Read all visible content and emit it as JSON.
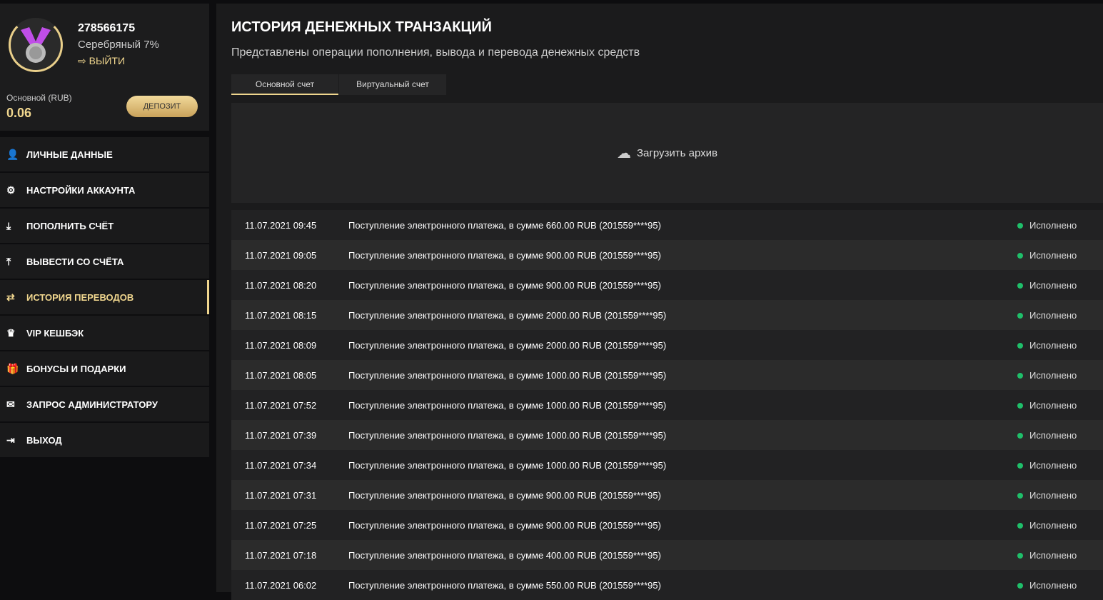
{
  "profile": {
    "user_id": "278566175",
    "rank": "Серебряный 7%",
    "logout": "ВЫЙТИ",
    "balance_label": "Основной (RUB)",
    "balance": "0.06",
    "deposit": "ДЕПОЗИТ"
  },
  "menu": [
    {
      "icon": "user-plus-icon",
      "glyph": "👤",
      "label": "ЛИЧНЫЕ ДАННЫЕ"
    },
    {
      "icon": "gears-icon",
      "glyph": "⚙",
      "label": "НАСТРОЙКИ АККАУНТА"
    },
    {
      "icon": "download-icon",
      "glyph": "⤓",
      "label": "ПОПОЛНИТЬ СЧЁТ"
    },
    {
      "icon": "upload-icon",
      "glyph": "⤒",
      "label": "ВЫВЕСТИ СО СЧЁТА"
    },
    {
      "icon": "exchange-icon",
      "glyph": "⇄",
      "label": "ИСТОРИЯ ПЕРЕВОДОВ",
      "active": true
    },
    {
      "icon": "crown-icon",
      "glyph": "♛",
      "label": "VIP КЕШБЭК"
    },
    {
      "icon": "gift-icon",
      "glyph": "🎁",
      "label": "БОНУСЫ И ПОДАРКИ"
    },
    {
      "icon": "envelope-icon",
      "glyph": "✉",
      "label": "ЗАПРОС АДМИНИСТРАТОРУ"
    },
    {
      "icon": "sign-out-icon",
      "glyph": "⇥",
      "label": "ВЫХОД"
    }
  ],
  "main": {
    "title": "ИСТОРИЯ ДЕНЕЖНЫХ ТРАНЗАКЦИЙ",
    "subtitle": "Представлены операции пополнения, вывода и перевода денежных средств",
    "tabs": [
      "Основной счет",
      "Виртуальный счет"
    ],
    "archive": "Загрузить архив"
  },
  "transactions": [
    {
      "date": "11.07.2021 09:45",
      "text": "Поступление электронного платежа, в сумме 660.00 RUB (201559****95)",
      "status": "Исполнено"
    },
    {
      "date": "11.07.2021 09:05",
      "text": "Поступление электронного платежа, в сумме 900.00 RUB (201559****95)",
      "status": "Исполнено"
    },
    {
      "date": "11.07.2021 08:20",
      "text": "Поступление электронного платежа, в сумме 900.00 RUB (201559****95)",
      "status": "Исполнено"
    },
    {
      "date": "11.07.2021 08:15",
      "text": "Поступление электронного платежа, в сумме 2000.00 RUB (201559****95)",
      "status": "Исполнено"
    },
    {
      "date": "11.07.2021 08:09",
      "text": "Поступление электронного платежа, в сумме 2000.00 RUB (201559****95)",
      "status": "Исполнено"
    },
    {
      "date": "11.07.2021 08:05",
      "text": "Поступление электронного платежа, в сумме 1000.00 RUB (201559****95)",
      "status": "Исполнено"
    },
    {
      "date": "11.07.2021 07:52",
      "text": "Поступление электронного платежа, в сумме 1000.00 RUB (201559****95)",
      "status": "Исполнено"
    },
    {
      "date": "11.07.2021 07:39",
      "text": "Поступление электронного платежа, в сумме 1000.00 RUB (201559****95)",
      "status": "Исполнено"
    },
    {
      "date": "11.07.2021 07:34",
      "text": "Поступление электронного платежа, в сумме 1000.00 RUB (201559****95)",
      "status": "Исполнено"
    },
    {
      "date": "11.07.2021 07:31",
      "text": "Поступление электронного платежа, в сумме 900.00 RUB (201559****95)",
      "status": "Исполнено"
    },
    {
      "date": "11.07.2021 07:25",
      "text": "Поступление электронного платежа, в сумме 900.00 RUB (201559****95)",
      "status": "Исполнено"
    },
    {
      "date": "11.07.2021 07:18",
      "text": "Поступление электронного платежа, в сумме 400.00 RUB (201559****95)",
      "status": "Исполнено"
    },
    {
      "date": "11.07.2021 06:02",
      "text": "Поступление электронного платежа, в сумме 550.00 RUB (201559****95)",
      "status": "Исполнено"
    }
  ]
}
